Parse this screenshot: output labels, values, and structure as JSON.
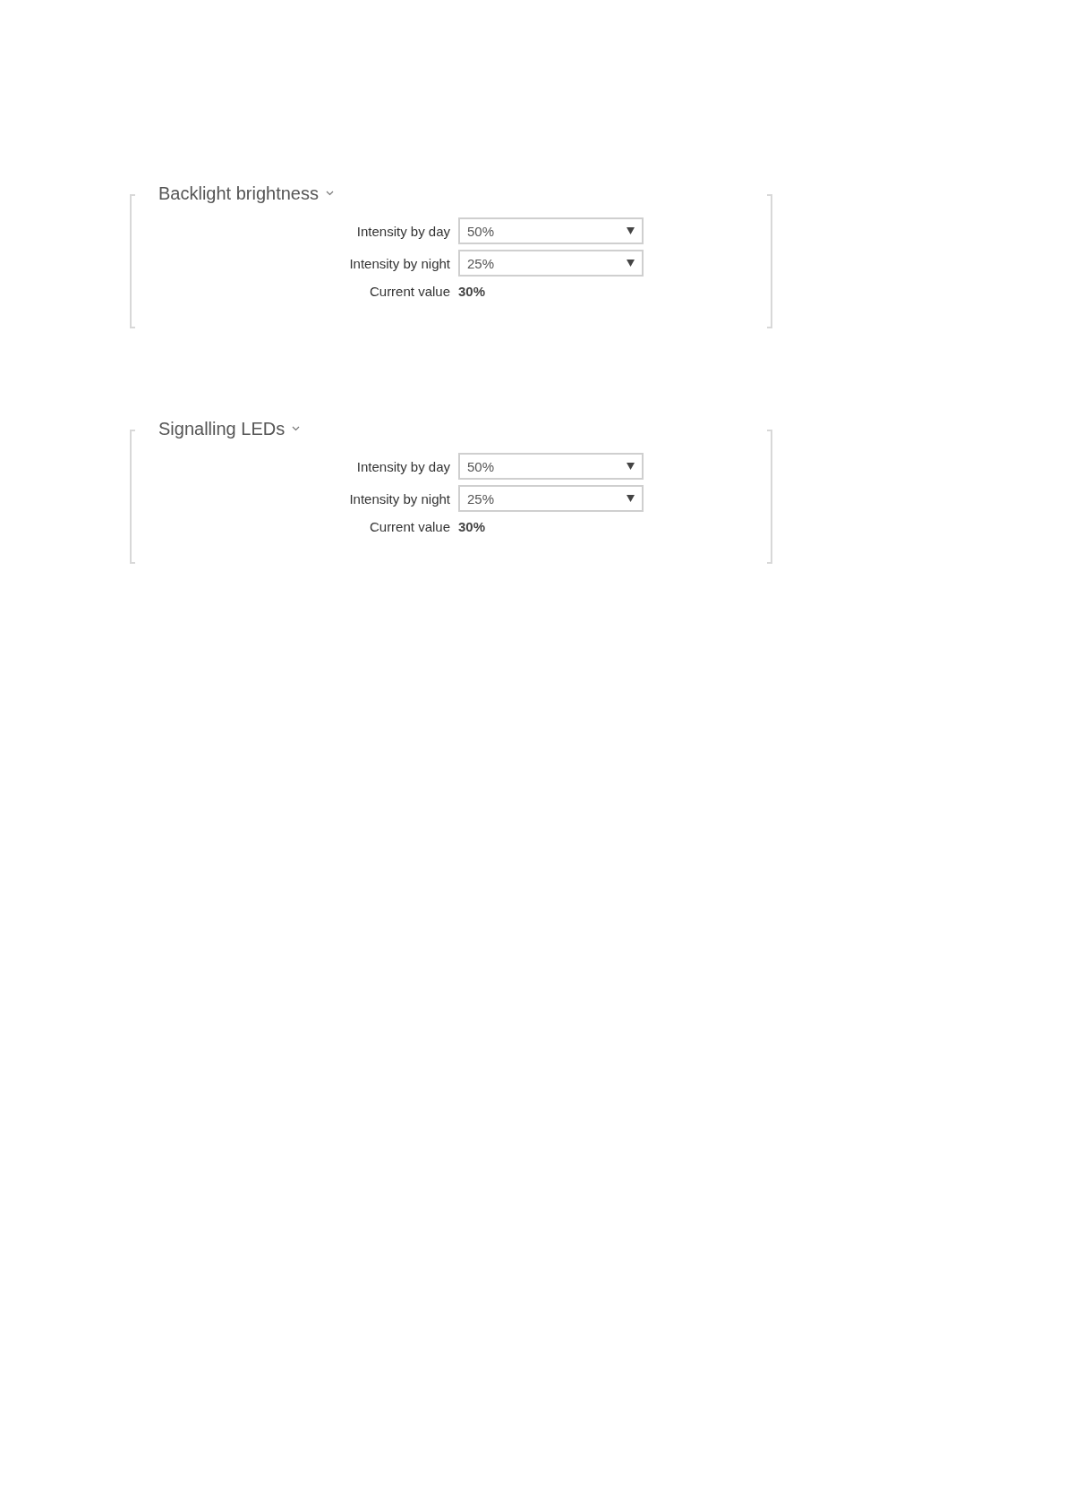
{
  "sections": [
    {
      "title": "Backlight brightness",
      "fields": [
        {
          "kind": "select",
          "label": "Intensity by day",
          "value": "50%"
        },
        {
          "kind": "select",
          "label": "Intensity by night",
          "value": "25%"
        },
        {
          "kind": "readout",
          "label": "Current value",
          "value": "30%"
        }
      ]
    },
    {
      "title": "Signalling LEDs",
      "fields": [
        {
          "kind": "select",
          "label": "Intensity by day",
          "value": "50%"
        },
        {
          "kind": "select",
          "label": "Intensity by night",
          "value": "25%"
        },
        {
          "kind": "readout",
          "label": "Current value",
          "value": "30%"
        }
      ]
    }
  ]
}
